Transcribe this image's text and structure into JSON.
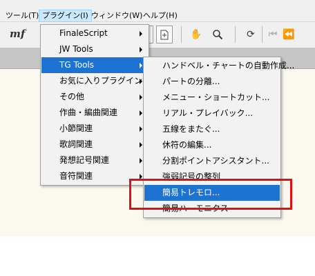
{
  "menubar": {
    "items": [
      {
        "label": "ツール(T)"
      },
      {
        "label": "プラグイン(I)"
      },
      {
        "label": "ウィンドウ(W)"
      },
      {
        "label": "ヘルプ(H)"
      }
    ]
  },
  "toolbar": {
    "logo": "mf",
    "icons": [
      "page-icon",
      "add-page-icon",
      "hand-tool-icon",
      "magnifier-icon",
      "refresh-icon",
      "first-icon",
      "rewind-icon"
    ]
  },
  "plugin_menu": {
    "items": [
      {
        "label": "FinaleScript"
      },
      {
        "label": "JW Tools"
      },
      {
        "label": "TG Tools"
      },
      {
        "label": "お気に入りプラグイン"
      },
      {
        "label": "その他"
      },
      {
        "label": "作曲・編曲関連"
      },
      {
        "label": "小節関連"
      },
      {
        "label": "歌詞関連"
      },
      {
        "label": "発想記号関連"
      },
      {
        "label": "音符関連"
      }
    ]
  },
  "tg_menu": {
    "items": [
      {
        "label": "ハンドベル・チャートの自動作成..."
      },
      {
        "label": "パートの分離..."
      },
      {
        "label": "メニュー・ショートカット..."
      },
      {
        "label": "リアル・プレイバック..."
      },
      {
        "label": "五線をまたぐ..."
      },
      {
        "label": "休符の編集..."
      },
      {
        "label": "分割ポイントアシスタント..."
      },
      {
        "label": "強弱記号の整列"
      },
      {
        "label": "簡易トレモロ..."
      },
      {
        "label": "簡易ハーモニクス"
      }
    ]
  },
  "colors": {
    "highlight": "#1e73d2",
    "annotation": "#e01010"
  }
}
